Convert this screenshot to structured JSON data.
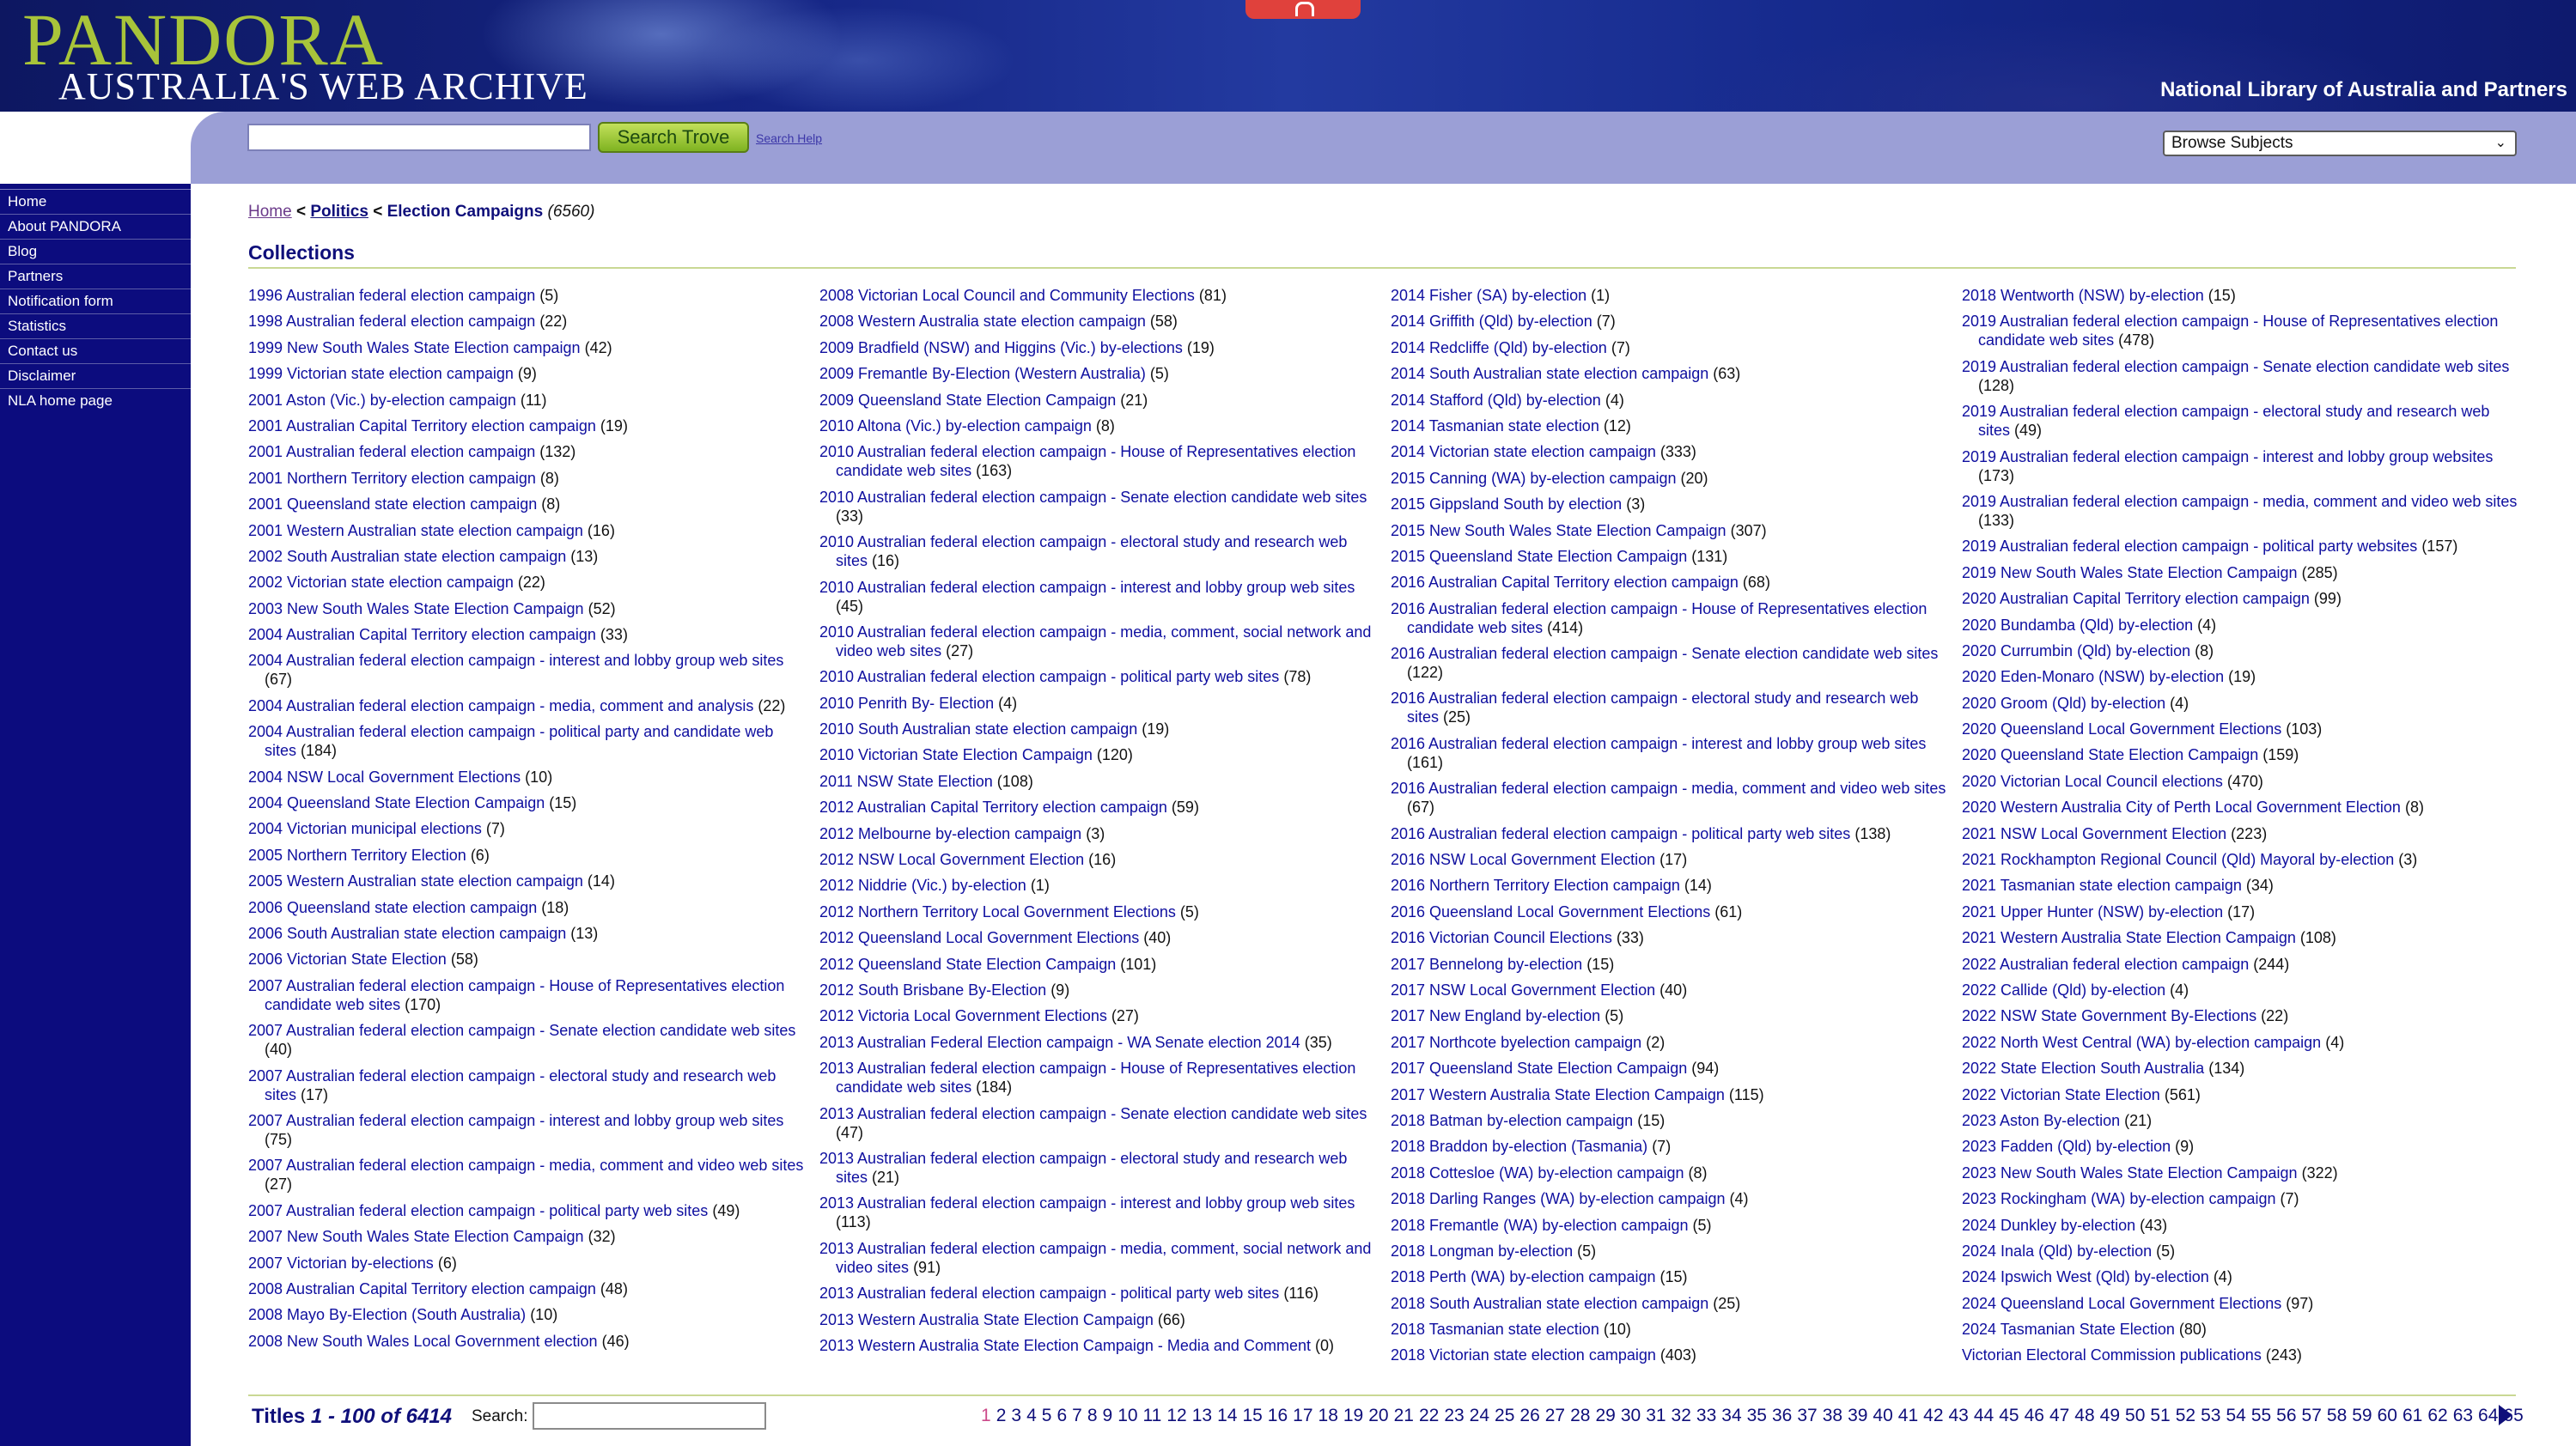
{
  "header": {
    "logo_main": "PANDORA",
    "logo_sub": "AUSTRALIA'S WEB ARCHIVE",
    "partners": "National Library of Australia and Partners"
  },
  "search": {
    "value": "",
    "button_label": "Search Trove",
    "help_label": "Search Help",
    "browse_label": "Browse Subjects"
  },
  "nav": {
    "items": [
      "Home",
      "About PANDORA",
      "Blog",
      "Partners",
      "Notification form",
      "Statistics",
      "Contact us",
      "Disclaimer",
      "NLA home page"
    ]
  },
  "breadcrumb": {
    "home": "Home",
    "sep": "<",
    "politics": "Politics",
    "current": "Election Campaigns",
    "count": "(6560)"
  },
  "collections_title": "Collections",
  "columns": [
    [
      {
        "t": "1996 Australian federal election campaign",
        "n": "(5)"
      },
      {
        "t": "1998 Australian federal election campaign",
        "n": "(22)"
      },
      {
        "t": "1999 New South Wales State Election campaign",
        "n": "(42)"
      },
      {
        "t": "1999 Victorian state election campaign",
        "n": "(9)"
      },
      {
        "t": "2001 Aston (Vic.) by-election campaign",
        "n": "(11)"
      },
      {
        "t": "2001 Australian Capital Territory election campaign",
        "n": "(19)"
      },
      {
        "t": "2001 Australian federal election campaign",
        "n": "(132)"
      },
      {
        "t": "2001 Northern Territory election campaign",
        "n": "(8)"
      },
      {
        "t": "2001 Queensland state election campaign",
        "n": "(8)"
      },
      {
        "t": "2001 Western Australian state election campaign",
        "n": "(16)"
      },
      {
        "t": "2002 South Australian state election campaign",
        "n": "(13)"
      },
      {
        "t": "2002 Victorian state election campaign",
        "n": "(22)"
      },
      {
        "t": "2003 New South Wales State Election Campaign",
        "n": "(52)"
      },
      {
        "t": "2004 Australian Capital Territory election campaign",
        "n": "(33)"
      },
      {
        "t": "2004 Australian federal election campaign - interest and lobby group web sites",
        "n": "(67)"
      },
      {
        "t": "2004 Australian federal election campaign - media, comment and analysis",
        "n": "(22)"
      },
      {
        "t": "2004 Australian federal election campaign - political party and candidate web sites",
        "n": "(184)"
      },
      {
        "t": "2004 NSW Local Government Elections",
        "n": "(10)"
      },
      {
        "t": "2004 Queensland State Election Campaign",
        "n": "(15)"
      },
      {
        "t": "2004 Victorian municipal elections",
        "n": "(7)"
      },
      {
        "t": "2005 Northern Territory Election",
        "n": "(6)"
      },
      {
        "t": "2005 Western Australian state election campaign",
        "n": "(14)"
      },
      {
        "t": "2006 Queensland state election campaign",
        "n": "(18)"
      },
      {
        "t": "2006 South Australian state election campaign",
        "n": "(13)"
      },
      {
        "t": "2006 Victorian State Election",
        "n": "(58)"
      },
      {
        "t": "2007 Australian federal election campaign - House of Representatives election candidate web sites",
        "n": "(170)"
      },
      {
        "t": "2007 Australian federal election campaign - Senate election candidate web sites",
        "n": "(40)"
      },
      {
        "t": "2007 Australian federal election campaign - electoral study and research web sites",
        "n": "(17)"
      },
      {
        "t": "2007 Australian federal election campaign - interest and lobby group web sites",
        "n": "(75)"
      },
      {
        "t": "2007 Australian federal election campaign - media, comment and video web sites",
        "n": "(27)"
      },
      {
        "t": "2007 Australian federal election campaign - political party web sites",
        "n": "(49)"
      },
      {
        "t": "2007 New South Wales State Election Campaign",
        "n": "(32)"
      },
      {
        "t": "2007 Victorian by-elections",
        "n": "(6)"
      },
      {
        "t": "2008 Australian Capital Territory election campaign",
        "n": "(48)"
      },
      {
        "t": "2008 Mayo By-Election (South Australia)",
        "n": "(10)"
      },
      {
        "t": "2008 New South Wales Local Government election",
        "n": "(46)"
      }
    ],
    [
      {
        "t": "2008 Victorian Local Council and Community Elections",
        "n": "(81)"
      },
      {
        "t": "2008 Western Australia state election campaign",
        "n": "(58)"
      },
      {
        "t": "2009 Bradfield (NSW) and Higgins (Vic.) by-elections",
        "n": "(19)"
      },
      {
        "t": "2009 Fremantle By-Election (Western Australia)",
        "n": "(5)"
      },
      {
        "t": "2009 Queensland State Election Campaign",
        "n": "(21)"
      },
      {
        "t": "2010 Altona (Vic.) by-election campaign",
        "n": "(8)"
      },
      {
        "t": "2010 Australian federal election campaign - House of Representatives election candidate web sites",
        "n": "(163)"
      },
      {
        "t": "2010 Australian federal election campaign - Senate election candidate web sites",
        "n": "(33)"
      },
      {
        "t": "2010 Australian federal election campaign - electoral study and research web sites",
        "n": "(16)"
      },
      {
        "t": "2010 Australian federal election campaign - interest and lobby group web sites",
        "n": "(45)"
      },
      {
        "t": "2010 Australian federal election campaign - media, comment, social network and video web sites",
        "n": "(27)"
      },
      {
        "t": "2010 Australian federal election campaign - political party web sites",
        "n": "(78)"
      },
      {
        "t": "2010 Penrith By- Election",
        "n": "(4)"
      },
      {
        "t": "2010 South Australian state election campaign",
        "n": "(19)"
      },
      {
        "t": "2010 Victorian State Election Campaign",
        "n": "(120)"
      },
      {
        "t": "2011 NSW State Election",
        "n": "(108)"
      },
      {
        "t": "2012 Australian Capital Territory election campaign",
        "n": "(59)"
      },
      {
        "t": "2012 Melbourne by-election campaign",
        "n": "(3)"
      },
      {
        "t": "2012 NSW Local Government Election",
        "n": "(16)"
      },
      {
        "t": "2012 Niddrie (Vic.) by-election",
        "n": "(1)"
      },
      {
        "t": "2012 Northern Territory Local Government Elections",
        "n": "(5)"
      },
      {
        "t": "2012 Queensland Local Government Elections",
        "n": "(40)"
      },
      {
        "t": "2012 Queensland State Election Campaign",
        "n": "(101)"
      },
      {
        "t": "2012 South Brisbane By-Election",
        "n": "(9)"
      },
      {
        "t": "2012 Victoria Local Government Elections",
        "n": "(27)"
      },
      {
        "t": "2013 Australian Federal Election campaign - WA Senate election 2014",
        "n": "(35)"
      },
      {
        "t": "2013 Australian federal election campaign - House of Representatives election candidate web sites",
        "n": "(184)"
      },
      {
        "t": "2013 Australian federal election campaign - Senate election candidate web sites",
        "n": "(47)"
      },
      {
        "t": "2013 Australian federal election campaign - electoral study and research web sites",
        "n": "(21)"
      },
      {
        "t": "2013 Australian federal election campaign - interest and lobby group web sites",
        "n": "(113)"
      },
      {
        "t": "2013 Australian federal election campaign - media, comment, social network and video sites",
        "n": "(91)"
      },
      {
        "t": "2013 Australian federal election campaign - political party web sites",
        "n": "(116)"
      },
      {
        "t": "2013 Western Australia State Election Campaign",
        "n": "(66)"
      },
      {
        "t": "2013 Western Australia State Election Campaign - Media and Comment",
        "n": "(0)"
      }
    ],
    [
      {
        "t": "2014 Fisher (SA) by-election",
        "n": "(1)"
      },
      {
        "t": "2014 Griffith (Qld) by-election",
        "n": "(7)"
      },
      {
        "t": "2014 Redcliffe (Qld) by-election",
        "n": "(7)"
      },
      {
        "t": "2014 South Australian state election campaign",
        "n": "(63)"
      },
      {
        "t": "2014 Stafford (Qld) by-election",
        "n": "(4)"
      },
      {
        "t": "2014 Tasmanian state election",
        "n": "(12)"
      },
      {
        "t": "2014 Victorian state election campaign",
        "n": "(333)"
      },
      {
        "t": "2015 Canning (WA) by-election campaign",
        "n": "(20)"
      },
      {
        "t": "2015 Gippsland South by election",
        "n": "(3)"
      },
      {
        "t": "2015 New South Wales State Election Campaign",
        "n": "(307)"
      },
      {
        "t": "2015 Queensland State Election Campaign",
        "n": "(131)"
      },
      {
        "t": "2016 Australian Capital Territory election campaign",
        "n": "(68)"
      },
      {
        "t": "2016 Australian federal election campaign - House of Representatives election candidate web sites",
        "n": "(414)"
      },
      {
        "t": "2016 Australian federal election campaign - Senate election candidate web sites",
        "n": "(122)"
      },
      {
        "t": "2016 Australian federal election campaign - electoral study and research web sites",
        "n": "(25)"
      },
      {
        "t": "2016 Australian federal election campaign - interest and lobby group web sites",
        "n": "(161)"
      },
      {
        "t": "2016 Australian federal election campaign - media, comment and video web sites",
        "n": "(67)"
      },
      {
        "t": "2016 Australian federal election campaign - political party web sites",
        "n": "(138)"
      },
      {
        "t": "2016 NSW Local Government Election",
        "n": "(17)"
      },
      {
        "t": "2016 Northern Territory Election campaign",
        "n": "(14)"
      },
      {
        "t": "2016 Queensland Local Government Elections",
        "n": "(61)"
      },
      {
        "t": "2016 Victorian Council Elections",
        "n": "(33)"
      },
      {
        "t": "2017 Bennelong by-election",
        "n": "(15)"
      },
      {
        "t": "2017 NSW Local Government Election",
        "n": "(40)"
      },
      {
        "t": "2017 New England by-election",
        "n": "(5)"
      },
      {
        "t": "2017 Northcote byelection campaign",
        "n": "(2)"
      },
      {
        "t": "2017 Queensland State Election Campaign",
        "n": "(94)"
      },
      {
        "t": "2017 Western Australia State Election Campaign",
        "n": "(115)"
      },
      {
        "t": "2018 Batman by-election campaign",
        "n": "(15)"
      },
      {
        "t": "2018 Braddon by-election (Tasmania)",
        "n": "(7)"
      },
      {
        "t": "2018 Cottesloe (WA) by-election campaign",
        "n": "(8)"
      },
      {
        "t": "2018 Darling Ranges (WA) by-election campaign",
        "n": "(4)"
      },
      {
        "t": "2018 Fremantle (WA) by-election campaign",
        "n": "(5)"
      },
      {
        "t": "2018 Longman by-election",
        "n": "(5)"
      },
      {
        "t": "2018 Perth (WA) by-election campaign",
        "n": "(15)"
      },
      {
        "t": "2018 South Australian state election campaign",
        "n": "(25)"
      },
      {
        "t": "2018 Tasmanian state election",
        "n": "(10)"
      },
      {
        "t": "2018 Victorian state election campaign",
        "n": "(403)"
      }
    ],
    [
      {
        "t": "2018 Wentworth (NSW) by-election",
        "n": "(15)"
      },
      {
        "t": "2019 Australian federal election campaign - House of Representatives election candidate web sites",
        "n": "(478)"
      },
      {
        "t": "2019 Australian federal election campaign - Senate election candidate web sites",
        "n": "(128)"
      },
      {
        "t": "2019 Australian federal election campaign - electoral study and research web sites",
        "n": "(49)"
      },
      {
        "t": "2019 Australian federal election campaign - interest and lobby group websites",
        "n": "(173)"
      },
      {
        "t": "2019 Australian federal election campaign - media, comment and video web sites",
        "n": "(133)"
      },
      {
        "t": "2019 Australian federal election campaign - political party websites",
        "n": "(157)"
      },
      {
        "t": "2019 New South Wales State Election Campaign",
        "n": "(285)"
      },
      {
        "t": "2020 Australian Capital Territory election campaign",
        "n": "(99)"
      },
      {
        "t": "2020 Bundamba (Qld) by-election",
        "n": "(4)"
      },
      {
        "t": "2020 Currumbin (Qld) by-election",
        "n": "(8)"
      },
      {
        "t": "2020 Eden-Monaro (NSW) by-election",
        "n": "(19)"
      },
      {
        "t": "2020 Groom (Qld) by-election",
        "n": "(4)"
      },
      {
        "t": "2020 Queensland Local Government Elections",
        "n": "(103)"
      },
      {
        "t": "2020 Queensland State Election Campaign",
        "n": "(159)"
      },
      {
        "t": "2020 Victorian Local Council elections",
        "n": "(470)"
      },
      {
        "t": "2020 Western Australia City of Perth Local Government Election",
        "n": "(8)"
      },
      {
        "t": "2021 NSW Local Government Election",
        "n": "(223)"
      },
      {
        "t": "2021 Rockhampton Regional Council (Qld) Mayoral by-election",
        "n": "(3)"
      },
      {
        "t": "2021 Tasmanian state election campaign",
        "n": "(34)"
      },
      {
        "t": "2021 Upper Hunter (NSW) by-election",
        "n": "(17)"
      },
      {
        "t": "2021 Western Australia State Election Campaign",
        "n": "(108)"
      },
      {
        "t": "2022 Australian federal election campaign",
        "n": "(244)"
      },
      {
        "t": "2022 Callide (Qld) by-election",
        "n": "(4)"
      },
      {
        "t": "2022 NSW State Government By-Elections",
        "n": "(22)"
      },
      {
        "t": "2022 North West Central (WA) by-election campaign",
        "n": "(4)"
      },
      {
        "t": "2022 State Election South Australia",
        "n": "(134)"
      },
      {
        "t": "2022 Victorian State Election",
        "n": "(561)"
      },
      {
        "t": "2023 Aston By-election",
        "n": "(21)"
      },
      {
        "t": "2023 Fadden (Qld) by-election",
        "n": "(9)"
      },
      {
        "t": "2023 New South Wales State Election Campaign",
        "n": "(322)"
      },
      {
        "t": "2023 Rockingham (WA) by-election campaign",
        "n": "(7)"
      },
      {
        "t": "2024 Dunkley by-election",
        "n": "(43)"
      },
      {
        "t": "2024 Inala (Qld) by-election",
        "n": "(5)"
      },
      {
        "t": "2024 Ipswich West (Qld) by-election",
        "n": "(4)"
      },
      {
        "t": "2024 Queensland Local Government Elections",
        "n": "(97)"
      },
      {
        "t": "2024 Tasmanian State Election",
        "n": "(80)"
      },
      {
        "t": "Victorian Electoral Commission publications",
        "n": "(243)"
      }
    ]
  ],
  "footer": {
    "titles_prefix": "Titles",
    "titles_range": "1 - 100 of 6414",
    "search_label": "Search:",
    "search_value": "",
    "pages": [
      "1",
      "2",
      "3",
      "4",
      "5",
      "6",
      "7",
      "8",
      "9",
      "10",
      "11",
      "12",
      "13",
      "14",
      "15",
      "16",
      "17",
      "18",
      "19",
      "20",
      "21",
      "22",
      "23",
      "24",
      "25",
      "26",
      "27",
      "28",
      "29",
      "30",
      "31",
      "32",
      "33",
      "34",
      "35",
      "36",
      "37",
      "38",
      "39",
      "40",
      "41",
      "42",
      "43",
      "44",
      "45",
      "46",
      "47",
      "48",
      "49",
      "50",
      "51",
      "52",
      "53",
      "54",
      "55",
      "56",
      "57",
      "58",
      "59",
      "60",
      "61",
      "62",
      "63",
      "64",
      "65"
    ],
    "current_page": "1"
  }
}
